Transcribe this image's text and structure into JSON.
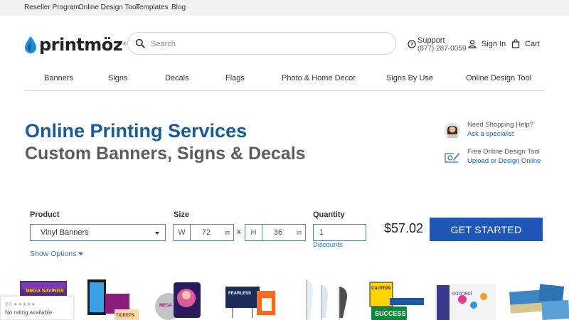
{
  "topbar": {
    "links": [
      "Reseller Program",
      "Online Design Tool",
      "Templates",
      "Blog"
    ]
  },
  "header": {
    "logo_text": "printmöz",
    "search_placeholder": "Search",
    "support_label": "Support",
    "support_phone": "(877) 287-0059",
    "signin_label": "Sign In",
    "cart_label": "Cart"
  },
  "nav": {
    "items": [
      "Banners",
      "Signs",
      "Decals",
      "Flags",
      "Photo & Home Decor",
      "Signs By Use",
      "Online Design Tool"
    ]
  },
  "hero": {
    "title": "Online Printing Services",
    "subtitle": "Custom Banners, Signs & Decals"
  },
  "help": {
    "specialist_caption": "Need Shopping Help?",
    "specialist_link": "Ask a specialist",
    "design_caption": "Free Online Design Tool",
    "design_link": "Upload or Design Online"
  },
  "configurator": {
    "product_label": "Product",
    "product_value": "Vinyl Banners",
    "size_label": "Size",
    "width_prefix": "W",
    "width_value": "72",
    "height_prefix": "H",
    "height_value": "36",
    "unit": "in",
    "times_symbol": "x",
    "quantity_label": "Quantity",
    "quantity_value": "1",
    "discounts_link": "Discounts",
    "show_options": "Show Options",
    "price": "$57.02",
    "cta": "GET STARTED"
  },
  "products_strip": {
    "texts": [
      "MEGA SAVINGS",
      "TICKETS",
      "MEGA SAVINGS",
      "FEARLESS",
      "CAUTION",
      "SUCCESS",
      "connect"
    ]
  },
  "rating_widget": {
    "stars_text": "0.0 ★★★★★",
    "text": "No rating available"
  },
  "colors": {
    "brand_blue": "#155a9c",
    "cta_blue": "#1f56b7",
    "link_blue": "#2d73c0",
    "topbar_bg": "#f2f2f2"
  }
}
